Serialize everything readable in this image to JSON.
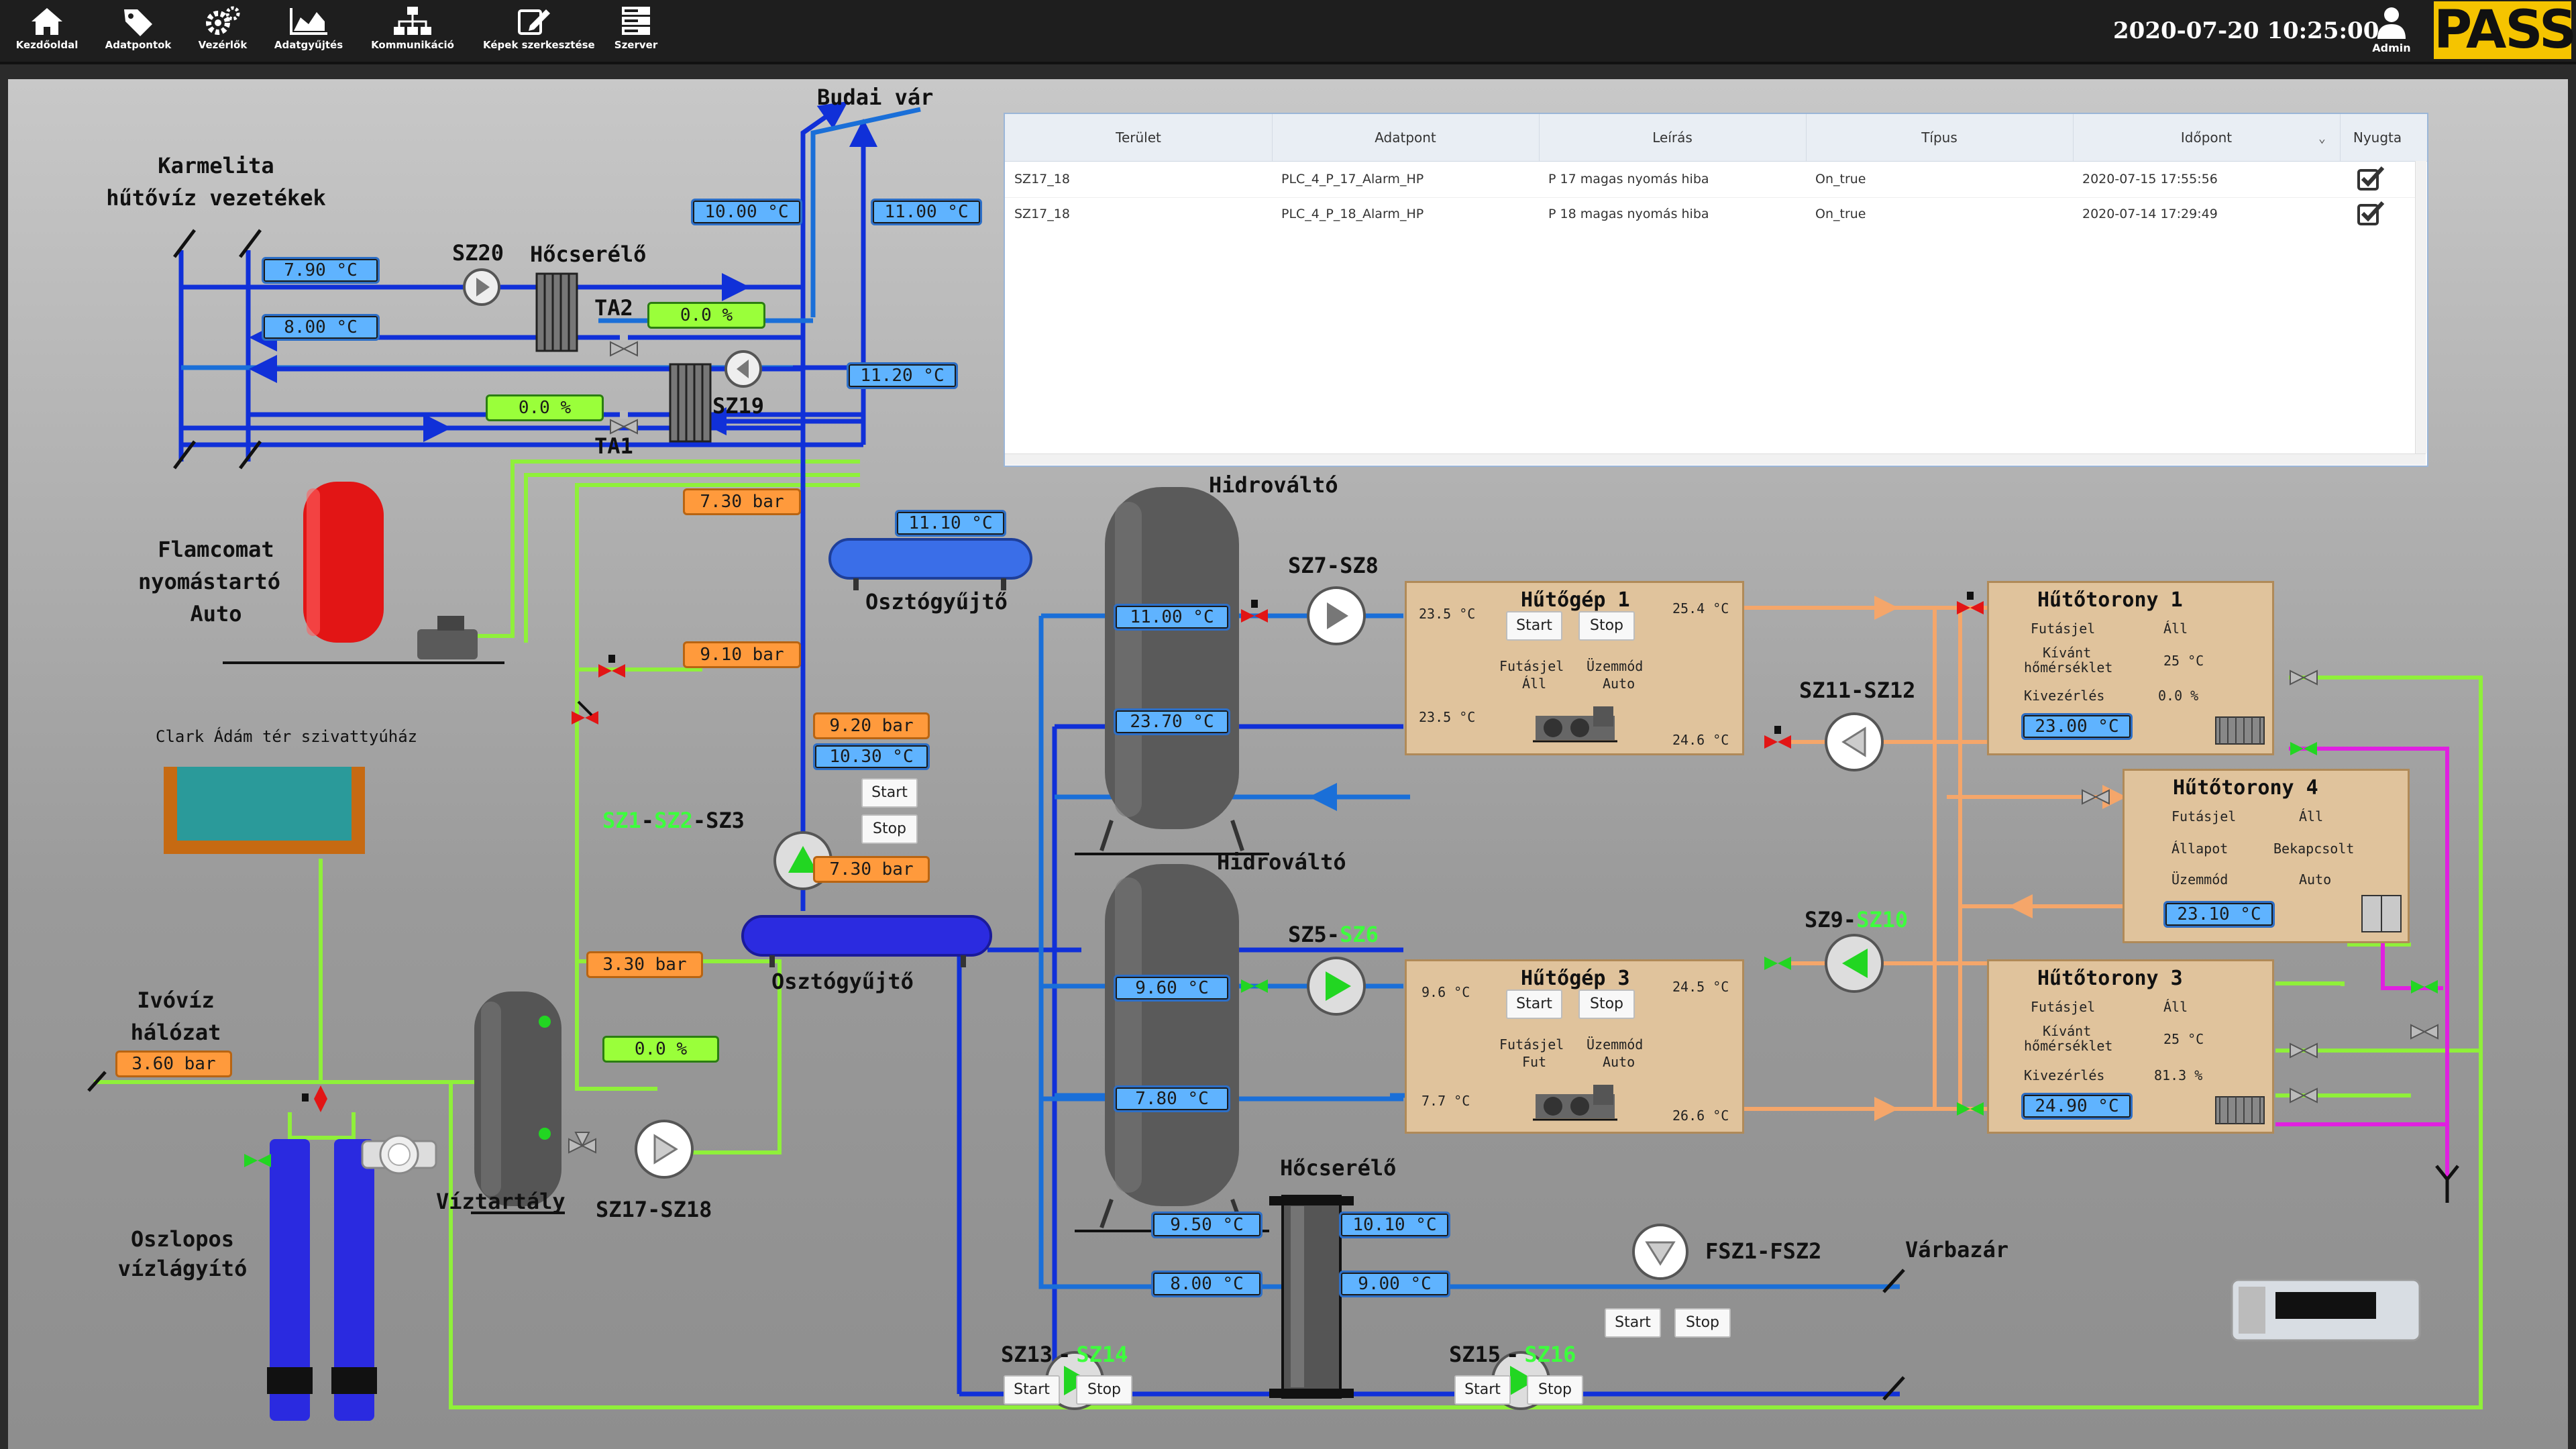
{
  "topbar": {
    "nav": [
      {
        "label": "Kezdőoldal",
        "icon": "home-icon"
      },
      {
        "label": "Adatpontok",
        "icon": "tag-icon"
      },
      {
        "label": "Vezérlők",
        "icon": "gears-icon"
      },
      {
        "label": "Adatgyűjtés",
        "icon": "area-chart-icon"
      },
      {
        "label": "Kommunikáció",
        "icon": "network-icon"
      },
      {
        "label": "Képek szerkesztése",
        "icon": "edit-icon"
      },
      {
        "label": "Szerver",
        "icon": "server-icon"
      }
    ],
    "datetime": "2020-07-20 10:25:00",
    "admin": "Admin",
    "logo": "PASS"
  },
  "alarm_table": {
    "columns": [
      "Terület",
      "Adatpont",
      "Leírás",
      "Típus",
      "Időpont",
      "Nyugta"
    ],
    "rows": [
      [
        "SZ17_18",
        "PLC_4_P_17_Alarm_HP",
        "P 17 magas nyomás hiba",
        "On_true",
        "2020-07-15 17:55:56"
      ],
      [
        "SZ17_18",
        "PLC_4_P_18_Alarm_HP",
        "P 18 magas nyomás hiba",
        "On_true",
        "2020-07-14 17:29:49"
      ]
    ]
  },
  "labels": {
    "budai_var": "Budai vár",
    "karmelita_1": "Karmelita",
    "karmelita_2": "hűtővíz vezetékek",
    "sz20": "SZ20",
    "hocserelo_top": "Hőcserélő",
    "ta2": "TA2",
    "sz19": "SZ19",
    "ta1": "TA1",
    "flamcomat_1": "Flamcomat",
    "flamcomat_2": "nyomástartó",
    "flamcomat_3": "Auto",
    "clark": "Clark Ádám tér szivattyúház",
    "ivoviz_1": "Ivóvíz",
    "ivoviz_2": "hálózat",
    "oszlopos_1": "Oszlopos",
    "oszlopos_2": "vízlágyító",
    "viztartaly": "Víztartály",
    "sz17_18": "SZ17-SZ18",
    "sz1": "SZ1",
    "sz2": "SZ2",
    "sz3": "SZ3",
    "dash": "-",
    "osztogyujto_1": "Osztógyűjtő",
    "osztogyujto_2": "Osztógyűjtő",
    "hidrovalto_1": "Hidrováltó",
    "hidrovalto_2": "Hidrováltó",
    "sz7_sz8": "SZ7-SZ8",
    "sz5": "SZ5-",
    "sz6": "SZ6",
    "sz11_sz12": "SZ11-SZ12",
    "sz9": "SZ9-",
    "sz10": "SZ10",
    "hocserelo_bottom": "Hőcserélő",
    "fsz": "FSZ1-FSZ2",
    "varbazar": "Várbazár",
    "sz13": "SZ13",
    "sz14": "SZ14",
    "sz15": "SZ15",
    "sz16": "SZ16"
  },
  "values": {
    "t_1000_a": "10.00 °C",
    "t_1100_a": "11.00 °C",
    "t_790": "7.90 °C",
    "t_800": "8.00 °C",
    "g_ta2": "0.0    %",
    "t_1120": "11.20 °C",
    "g_ta1": "0.0    %",
    "p_730_a": "7.30 bar",
    "t_1110": "11.10 °C",
    "p_910": "9.10 bar",
    "p_920": "9.20 bar",
    "t_1030": "10.30 °C",
    "p_730_b": "7.30 bar",
    "p_330": "3.30 bar",
    "g_tank": "0.0    %",
    "p_360": "3.60 bar",
    "t_1100_b": "11.00 °C",
    "t_2370": "23.70 °C",
    "t_960": "9.60 °C",
    "t_780": "7.80 °C",
    "t_950": "9.50 °C",
    "t_1010": "10.10 °C",
    "t_800_b": "8.00 °C",
    "t_900": "9.00 °C"
  },
  "buttons": {
    "start": "Start",
    "stop": "Stop"
  },
  "chillers": [
    {
      "title": "Hűtőgép 1",
      "tl": "23.5  °C",
      "tr": "25.4  °C",
      "bl": "23.5  °C",
      "br": "24.6  °C",
      "run_label": "Futásjel",
      "run": "Áll",
      "mode_label": "Üzemmód",
      "mode": "Auto"
    },
    {
      "title": "Hűtőgép 3",
      "tl": "9.6  °C",
      "tr": "24.5  °C",
      "bl": "7.7  °C",
      "br": "26.6  °C",
      "run_label": "Futásjel",
      "run": "Fut",
      "mode_label": "Üzemmód",
      "mode": "Auto"
    }
  ],
  "towers": [
    {
      "title": "Hűtőtorony 1",
      "run_label": "Futásjel",
      "run": "Áll",
      "set_label_1": "Kívánt",
      "set_label_2": "hőmérséklet",
      "set": "25  °C",
      "ctrl_label": "Kivezérlés",
      "ctrl": "0.0  %",
      "temp": "23.00 °C"
    },
    {
      "title": "Hűtőtorony 4",
      "run_label": "Futásjel",
      "run": "Áll",
      "state_label": "Állapot",
      "state": "Bekapcsolt",
      "mode_label": "Üzemmód",
      "mode": "Auto",
      "temp": "23.10 °C"
    },
    {
      "title": "Hűtőtorony 3",
      "run_label": "Futásjel",
      "run": "Áll",
      "set_label_1": "Kívánt",
      "set_label_2": "hőmérséklet",
      "set": "25  °C",
      "ctrl_label": "Kivezérlés",
      "ctrl": "81.3  %",
      "temp": "24.90 °C"
    }
  ],
  "colors": {
    "supply": "#1030d8",
    "return": "#1a6fd8",
    "green_pipe": "#8ff03a",
    "orange_pipe": "#f5a66a",
    "magenta_pipe": "#e020e0",
    "pump_on": "#22d622"
  }
}
